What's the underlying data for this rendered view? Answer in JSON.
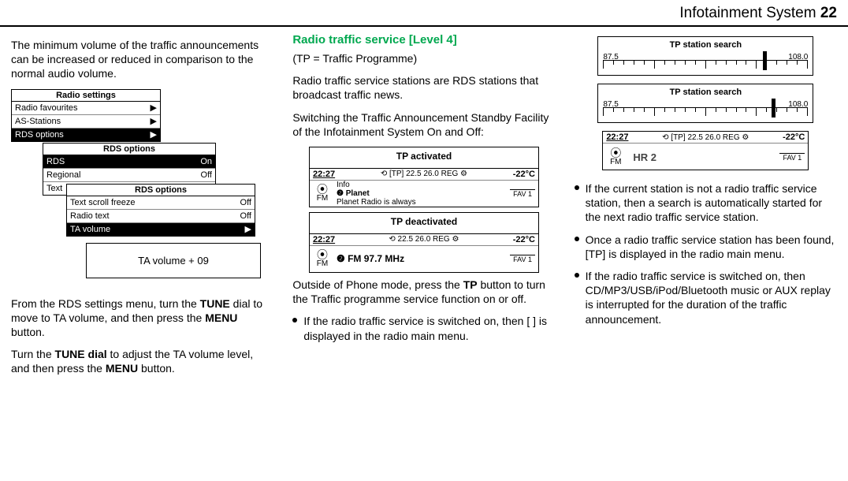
{
  "header": {
    "title": "Infotainment System",
    "page_num": "22"
  },
  "col1": {
    "intro": "The minimum volume of the traffic announcements can be increased or reduced in comparison to the normal audio volume.",
    "menu1": {
      "title": "Radio settings",
      "rows": [
        {
          "label": "Radio favourites",
          "value": "▶"
        },
        {
          "label": "AS-Stations",
          "value": "▶"
        },
        {
          "label": "RDS options",
          "value": "▶",
          "sel": true
        }
      ]
    },
    "menu2": {
      "title": "RDS options",
      "rows": [
        {
          "label": "RDS",
          "value": "On",
          "sel": true
        },
        {
          "label": "Regional",
          "value": "Off"
        },
        {
          "label": "Text",
          "value": ""
        }
      ]
    },
    "menu3": {
      "title": "RDS options",
      "rows": [
        {
          "label": "Text scroll freeze",
          "value": "Off"
        },
        {
          "label": "Radio text",
          "value": "Off"
        },
        {
          "label": "TA volume",
          "value": "▶",
          "sel": true
        }
      ]
    },
    "ta_box": "TA volume + 09",
    "para2_a": "From the RDS settings menu, turn the ",
    "para2_b": "TUNE",
    "para2_c": " dial to move to TA volume, and then press the ",
    "para2_d": "MENU",
    "para2_e": " button.",
    "para3_a": "Turn the ",
    "para3_b": "TUNE dial",
    "para3_c": " to adjust the TA volume level, and then press the ",
    "para3_d": "MENU",
    "para3_e": " button."
  },
  "col2": {
    "heading": "Radio traffic service [Level 4]",
    "tp_eq": "(TP = Traffic Programme)",
    "desc": "Radio traffic service stations are RDS stations that broadcast traffic news.",
    "switch_heading": "Switching the Traffic Announcement Standby Facility of the Infotainment System On and Off:",
    "disp1": {
      "top": "TP activated",
      "status": {
        "time": "22:27",
        "mid": "⟲  [TP] 22.5 26.0 REG  ⚙",
        "temp": "-22°C"
      },
      "band": "FM",
      "line1": "Info",
      "line2": "❷ Planet",
      "line3": "Planet Radio is always",
      "fav": "FAV 1"
    },
    "disp2": {
      "top": "TP deactivated",
      "status": {
        "time": "22:27",
        "mid": "⟲     22.5 26.0 REG  ⚙",
        "temp": "-22°C"
      },
      "band": "FM",
      "line2": "❷ FM 97.7 MHz",
      "fav": "FAV 1"
    },
    "outside_a": "Outside of Phone mode, press the ",
    "outside_b": "TP",
    "outside_c": " button to turn the Traffic programme service function on or off.",
    "bullet1": "If the radio traffic service is switched on, then [ ] is displayed in the radio main menu."
  },
  "col3": {
    "search": {
      "title": "TP station search",
      "left": "87.5",
      "right": "108.0"
    },
    "hr2": {
      "status": {
        "time": "22:27",
        "mid": "⟲  [TP] 22.5 26.0 REG  ⚙",
        "temp": "-22°C"
      },
      "band": "FM",
      "station": "HR 2",
      "fav": "FAV 1"
    },
    "b1": "If the current station is not a radio traffic service station, then a search is automatically started for the next radio traffic service station.",
    "b2": "Once a radio traffic service station has been found, [TP] is displayed in the radio main menu.",
    "b3": "If the radio traffic service is switched on, then CD/MP3/USB/iPod/Bluetooth music or AUX replay is interrupted for the duration of the traffic announcement."
  }
}
